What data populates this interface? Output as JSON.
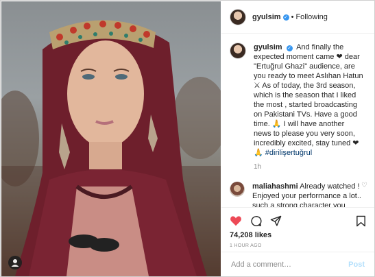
{
  "post": {
    "author": "gyulsim",
    "dot": "•",
    "follow_label": "Following",
    "verified_glyph": "✓"
  },
  "caption": {
    "username": "gyulsim",
    "text": "And finally the expected moment came ❤ dear \"Ertuğrul Ghazi\" audience, are you ready to meet Aslıhan Hatun ⚔ As of today, the 3rd season, which is the season that I liked the most , started broadcasting on Pakistani TVs. Have a good time. 🙏 I will have another news to please you very soon, incredibly excited, stay tuned ❤🙏",
    "hashtag": "#dirilişertuğrul",
    "time": "1h"
  },
  "comment": {
    "username": "maliahashmi",
    "text": "Already watched ! Enjoyed your performance a lot.. such a strong character you played ❤ beyond beautiful❤❤ love you 🙏🙏",
    "heart_glyph": "♡"
  },
  "actions": {
    "likes": "74,208 likes",
    "posted": "1 HOUR AGO"
  },
  "add_comment": {
    "placeholder": "Add a comment…",
    "post_label": "Post"
  },
  "colors": {
    "like_red": "#ed4956",
    "link_blue": "#00376b",
    "verified_blue": "#3897f0"
  }
}
